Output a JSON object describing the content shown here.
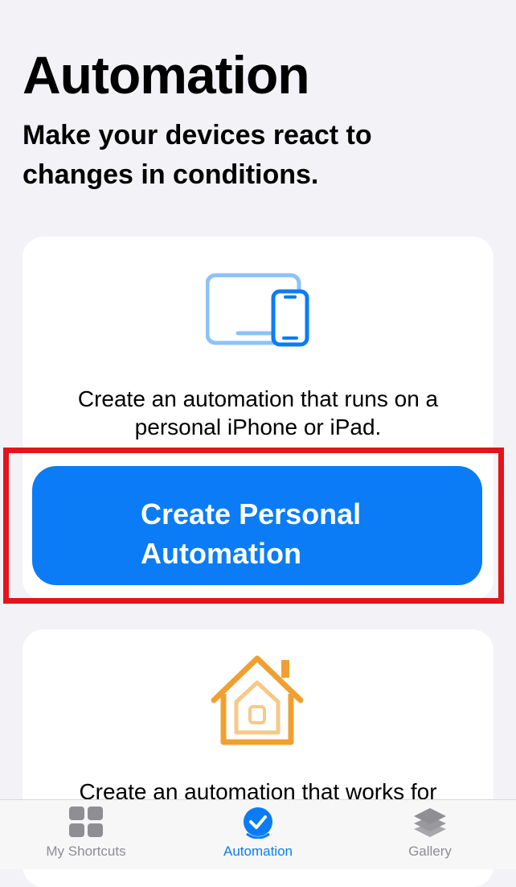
{
  "header": {
    "title": "Automation",
    "subtitle": "Make your devices react to changes in conditions."
  },
  "personal_card": {
    "icon": "iphone-ipad-icon",
    "description": "Create an automation that runs on a personal iPhone or iPad.",
    "button_label_line1": "Create Personal",
    "button_label_line2": "Automation"
  },
  "home_card": {
    "icon": "home-icon",
    "description": "Create an automation that works for"
  },
  "tabbar": {
    "tabs": [
      {
        "label": "My Shortcuts",
        "icon": "grid-icon",
        "selected": false
      },
      {
        "label": "Automation",
        "icon": "automation-check-icon",
        "selected": true
      },
      {
        "label": "Gallery",
        "icon": "layers-icon",
        "selected": false
      }
    ]
  },
  "colors": {
    "accent": "#0b7cf5",
    "highlight": "#e3141b",
    "home_icon": "#f0a030",
    "device_icon_light": "#8cc2f8"
  }
}
